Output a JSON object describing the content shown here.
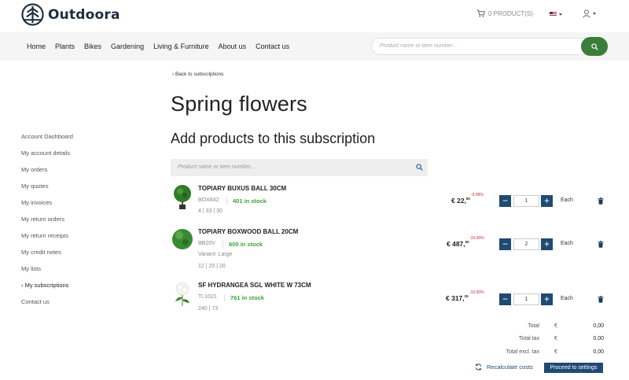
{
  "brand": {
    "name": "Outdoora"
  },
  "header": {
    "cart_label": "0 PRODUCT(S)",
    "search_placeholder": "Product name or item number..."
  },
  "nav": {
    "items": [
      "Home",
      "Plants",
      "Bikes",
      "Gardening",
      "Living & Furniture",
      "About us",
      "Contact us"
    ]
  },
  "sidebar": {
    "items": [
      "Account Dashboard",
      "My account details",
      "My orders",
      "My quotes",
      "My invoices",
      "My return orders",
      "My return receipts",
      "My credit notes",
      "My lists",
      "› My subscriptions",
      "Contact us"
    ]
  },
  "main": {
    "back_link": "‹  Back to subscriptions",
    "title": "Spring flowers",
    "section_title": "Add products to this subscription",
    "search_placeholder": "Product name or item number..."
  },
  "products": [
    {
      "name": "TOPIARY BUXUS BALL 30CM",
      "sku": "BOX842",
      "stock": "401 in stock",
      "dims": "4 | 33 | 30",
      "price_main": "€ 22,",
      "price_cents": "50",
      "discount": "-9.99%",
      "qty": "1",
      "unit": "Each"
    },
    {
      "name": "TOPIARY BOXWOOD BALL 20CM",
      "sku": "BB20V",
      "stock": "600 in stock",
      "variant": "Variant: Large",
      "dims": "12 | 20 | 20",
      "price_main": "€ 487,",
      "price_cents": "50",
      "discount": "-10.00%",
      "qty": "2",
      "unit": "Each"
    },
    {
      "name": "SF HYDRANGEA SGL WHITE W 73CM",
      "sku": "TI.1021",
      "stock": "761 in stock",
      "dims": "240 | 73",
      "price_main": "€ 317,",
      "price_cents": "25",
      "discount": "-10.00%",
      "qty": "1",
      "unit": "Each"
    }
  ],
  "totals": [
    {
      "label": "Total",
      "currency": "€",
      "value": "0,00"
    },
    {
      "label": "Total tax",
      "currency": "€",
      "value": "0,00"
    },
    {
      "label": "Total excl. tax",
      "currency": "€",
      "value": "0,00"
    }
  ],
  "actions": {
    "recalculate": "Recalculate costs",
    "proceed": "Proceed to settings"
  },
  "colors": {
    "primary": "#1f4a73",
    "accent_green": "#3b7d3a",
    "stock_green": "#3ba23b",
    "discount_red": "#c82828"
  }
}
